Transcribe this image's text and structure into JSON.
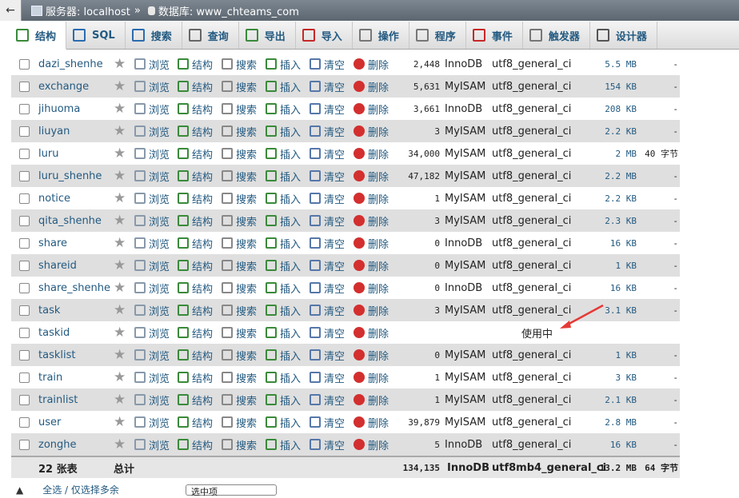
{
  "breadcrumb": {
    "server_label": "服务器: localhost",
    "separator": "»",
    "db_label": "数据库: www_chteams_com"
  },
  "tabs": [
    {
      "label": "结构",
      "icon": "structure-icon",
      "active": true
    },
    {
      "label": "SQL",
      "icon": "sql-icon"
    },
    {
      "label": "搜索",
      "icon": "search-icon"
    },
    {
      "label": "查询",
      "icon": "query-icon"
    },
    {
      "label": "导出",
      "icon": "export-icon"
    },
    {
      "label": "导入",
      "icon": "import-icon"
    },
    {
      "label": "操作",
      "icon": "wrench-icon"
    },
    {
      "label": "程序",
      "icon": "routines-icon"
    },
    {
      "label": "事件",
      "icon": "clock-icon"
    },
    {
      "label": "触发器",
      "icon": "trigger-icon"
    },
    {
      "label": "设计器",
      "icon": "designer-icon"
    }
  ],
  "actions": {
    "browse": "浏览",
    "structure": "结构",
    "search": "搜索",
    "insert": "插入",
    "empty": "清空",
    "drop": "删除"
  },
  "tables": [
    {
      "name": "dazi_shenhe",
      "rows": "2,448",
      "engine": "InnoDB",
      "collation": "utf8_general_ci",
      "size": "5.5 MB",
      "overhead": "-"
    },
    {
      "name": "exchange",
      "rows": "5,631",
      "engine": "MyISAM",
      "collation": "utf8_general_ci",
      "size": "154 KB",
      "overhead": "-"
    },
    {
      "name": "jihuoma",
      "rows": "3,661",
      "engine": "InnoDB",
      "collation": "utf8_general_ci",
      "size": "208 KB",
      "overhead": "-"
    },
    {
      "name": "liuyan",
      "rows": "3",
      "engine": "MyISAM",
      "collation": "utf8_general_ci",
      "size": "2.2 KB",
      "overhead": "-"
    },
    {
      "name": "luru",
      "rows": "34,000",
      "engine": "MyISAM",
      "collation": "utf8_general_ci",
      "size": "2 MB",
      "overhead": "40 字节"
    },
    {
      "name": "luru_shenhe",
      "rows": "47,182",
      "engine": "MyISAM",
      "collation": "utf8_general_ci",
      "size": "2.2 MB",
      "overhead": "-"
    },
    {
      "name": "notice",
      "rows": "1",
      "engine": "MyISAM",
      "collation": "utf8_general_ci",
      "size": "2.2 KB",
      "overhead": "-"
    },
    {
      "name": "qita_shenhe",
      "rows": "3",
      "engine": "MyISAM",
      "collation": "utf8_general_ci",
      "size": "2.3 KB",
      "overhead": "-"
    },
    {
      "name": "share",
      "rows": "0",
      "engine": "InnoDB",
      "collation": "utf8_general_ci",
      "size": "16 KB",
      "overhead": "-"
    },
    {
      "name": "shareid",
      "rows": "0",
      "engine": "MyISAM",
      "collation": "utf8_general_ci",
      "size": "1 KB",
      "overhead": "-"
    },
    {
      "name": "share_shenhe",
      "rows": "0",
      "engine": "InnoDB",
      "collation": "utf8_general_ci",
      "size": "16 KB",
      "overhead": "-"
    },
    {
      "name": "task",
      "rows": "3",
      "engine": "MyISAM",
      "collation": "utf8_general_ci",
      "size": "3.1 KB",
      "overhead": "-"
    },
    {
      "name": "taskid",
      "in_use": "使用中"
    },
    {
      "name": "tasklist",
      "rows": "0",
      "engine": "MyISAM",
      "collation": "utf8_general_ci",
      "size": "1 KB",
      "overhead": "-"
    },
    {
      "name": "train",
      "rows": "1",
      "engine": "MyISAM",
      "collation": "utf8_general_ci",
      "size": "3 KB",
      "overhead": "-"
    },
    {
      "name": "trainlist",
      "rows": "1",
      "engine": "MyISAM",
      "collation": "utf8_general_ci",
      "size": "2.1 KB",
      "overhead": "-"
    },
    {
      "name": "user",
      "rows": "39,879",
      "engine": "MyISAM",
      "collation": "utf8_general_ci",
      "size": "2.8 MB",
      "overhead": "-"
    },
    {
      "name": "zonghe",
      "rows": "5",
      "engine": "InnoDB",
      "collation": "utf8_general_ci",
      "size": "16 KB",
      "overhead": "-"
    }
  ],
  "footer": {
    "count": "22 张表",
    "total_label": "总计",
    "rows": "134,135",
    "engine": "InnoDB",
    "collation": "utf8mb4_general_ci",
    "size": "13.2 MB",
    "overhead": "64 字节"
  },
  "bottom": {
    "check_all": "全选 / 仅选择多余",
    "select_placeholder": "选中项"
  },
  "colors": {
    "link": "#235a81",
    "arrow": "#e53935",
    "drop": "#d32f2f"
  }
}
